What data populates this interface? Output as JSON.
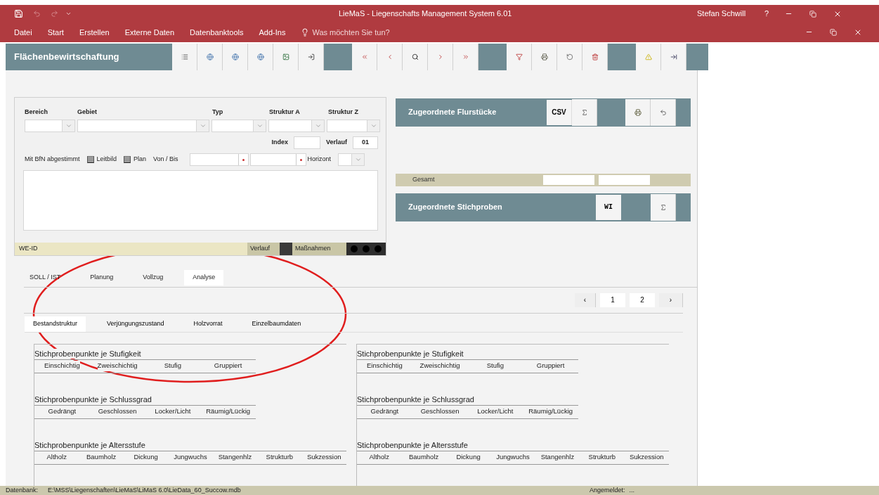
{
  "window": {
    "title": "LieMaS - Liegenschafts Management System 6.01",
    "user": "Stefan Schwill",
    "help": "?"
  },
  "menu": [
    {
      "label": "Datei"
    },
    {
      "label": "Start"
    },
    {
      "label": "Erstellen"
    },
    {
      "label": "Externe Daten"
    },
    {
      "label": "Datenbanktools"
    },
    {
      "label": "Add-Ins"
    }
  ],
  "tell_me": {
    "placeholder": "Was möchten Sie tun?"
  },
  "form_title": "Flächenbewirtschaftung",
  "filter": {
    "labels": [
      "Bereich",
      "Gebiet",
      "Typ",
      "Struktur A",
      "Struktur Z"
    ],
    "index_label": "Index",
    "verlauf_label": "Verlauf",
    "verlauf_value": "01",
    "bfn_label": "Mit BfN abgestimmt",
    "checks": [
      {
        "label": "Leitbild",
        "checked": true
      },
      {
        "label": "Plan",
        "checked": true
      }
    ],
    "von_bis_label": "Von / Bis",
    "horizont_label": "Horizont"
  },
  "we_bar": {
    "id_label": "WE-ID",
    "verlauf": "Verlauf",
    "massnahmen": "Maßnahmen"
  },
  "flurstuecke": {
    "title": "Zugeordnete Flurstücke",
    "csv": "CSV",
    "total_label": "Gesamt"
  },
  "stichproben": {
    "title": "Zugeordnete Stichproben",
    "wi": "WI"
  },
  "tabs": [
    {
      "label": "SOLL / IST",
      "selected": false
    },
    {
      "label": "Planung",
      "selected": false
    },
    {
      "label": "Vollzug",
      "selected": false
    },
    {
      "label": "Analyse",
      "selected": true
    }
  ],
  "pager": {
    "prev": "‹",
    "pages": [
      {
        "label": "1",
        "selected": false
      },
      {
        "label": "2",
        "selected": false
      }
    ],
    "next": "›"
  },
  "subtabs": [
    {
      "label": "Bestandstruktur",
      "selected": true
    },
    {
      "label": "Verjüngungszustand",
      "selected": false
    },
    {
      "label": "Holzvorrat",
      "selected": false
    },
    {
      "label": "Einzelbaumdaten",
      "selected": false
    }
  ],
  "columns": [
    {
      "groups": [
        {
          "title": "Stichprobenpunkte je Stufigkeit",
          "headers": [
            "Einschichtig",
            "Zweischichtig",
            "Stufig",
            "Gruppiert"
          ]
        },
        {
          "title": "Stichprobenpunkte je Schlussgrad",
          "headers": [
            "Gedrängt",
            "Geschlossen",
            "Locker/Licht",
            "Räumig/Lückig"
          ]
        },
        {
          "title": "Stichprobenpunkte je Altersstufe",
          "headers": [
            "Altholz",
            "Baumholz",
            "Dickung",
            "Jungwuchs",
            "Stangenhlz",
            "Strukturb",
            "Sukzession"
          ]
        }
      ]
    },
    {
      "groups": [
        {
          "title": "Stichprobenpunkte je Stufigkeit",
          "headers": [
            "Einschichtig",
            "Zweischichtig",
            "Stufig",
            "Gruppiert"
          ]
        },
        {
          "title": "Stichprobenpunkte je Schlussgrad",
          "headers": [
            "Gedrängt",
            "Geschlossen",
            "Locker/Licht",
            "Räumig/Lückig"
          ]
        },
        {
          "title": "Stichprobenpunkte je Altersstufe",
          "headers": [
            "Altholz",
            "Baumholz",
            "Dickung",
            "Jungwuchs",
            "Stangenhlz",
            "Strukturb",
            "Sukzession"
          ]
        }
      ]
    }
  ],
  "status_bar": {
    "db_label": "Datenbank:",
    "db_path": "E:\\MSS\\Liegenschaften\\LieMaS\\LiMaS 6.0\\LieData_60_Succow.mdb",
    "login_label": "Angemeldet:",
    "login_value": "..."
  }
}
